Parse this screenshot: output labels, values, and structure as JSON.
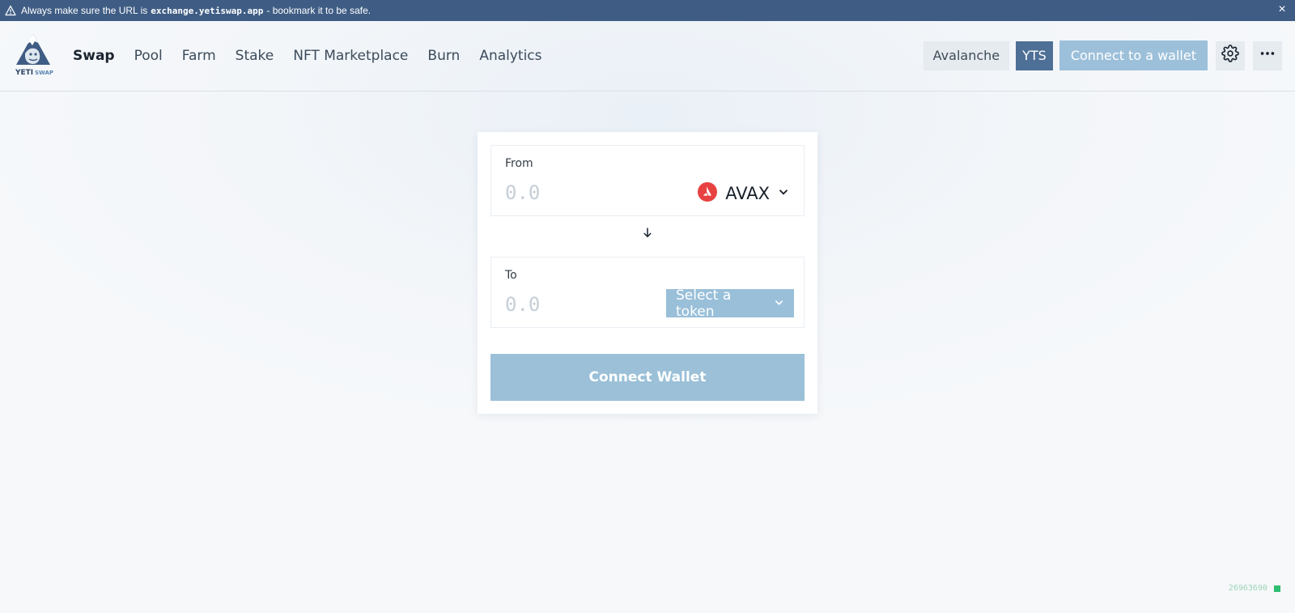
{
  "banner": {
    "text_before": "Always make sure the URL is",
    "url": "exchange.yetiswap.app",
    "text_after": "- bookmark it to be safe.",
    "close_icon": "×"
  },
  "header": {
    "logo_alt": "YETI SWAP",
    "nav": [
      {
        "label": "Swap",
        "active": true
      },
      {
        "label": "Pool"
      },
      {
        "label": "Farm"
      },
      {
        "label": "Stake"
      },
      {
        "label": "NFT Marketplace"
      },
      {
        "label": "Burn"
      },
      {
        "label": "Analytics"
      }
    ],
    "network_label": "Avalanche",
    "token_chip_label": "YTS",
    "connect_label": "Connect to a wallet",
    "settings_icon": "gear-icon",
    "more_icon": "more-horizontal-icon"
  },
  "swap": {
    "from": {
      "label": "From",
      "placeholder": "0.0",
      "token": "AVAX",
      "token_icon": "avax-icon"
    },
    "to": {
      "label": "To",
      "placeholder": "0.0",
      "select_label": "Select a token"
    },
    "arrow_icon": "arrow-down-icon",
    "connect_button_label": "Connect Wallet"
  },
  "footer": {
    "block_number": "26963690",
    "status_color": "#2ebd72"
  },
  "colors": {
    "banner_bg": "#3f5d84",
    "accent_light": "#9bc0d8",
    "yts_chip": "#4e6f96",
    "avax_red": "#e84142"
  }
}
